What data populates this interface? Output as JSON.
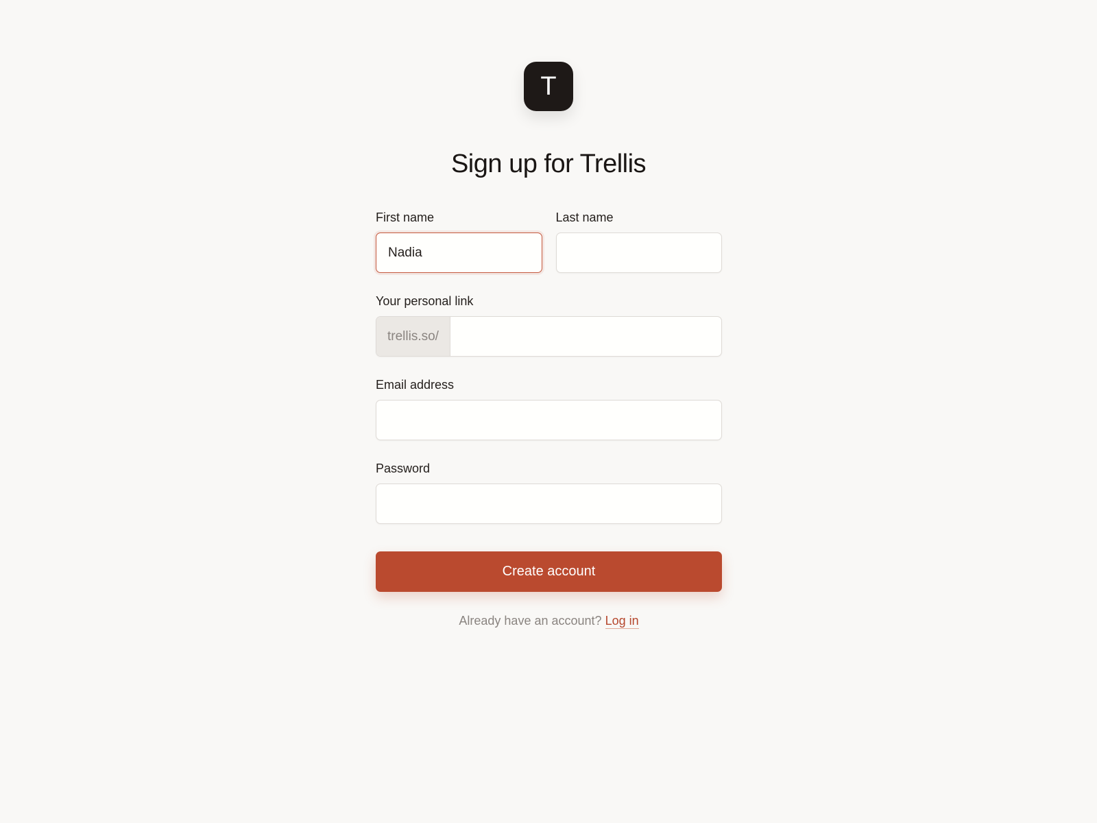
{
  "app": {
    "logo_letter": "T",
    "title": "Sign up for Trellis"
  },
  "form": {
    "first_name": {
      "label": "First name",
      "value": "Nadia",
      "placeholder": ""
    },
    "last_name": {
      "label": "Last name",
      "value": "",
      "placeholder": ""
    },
    "personal_link": {
      "label": "Your personal link",
      "prefix": "trellis.so/",
      "value": ""
    },
    "email": {
      "label": "Email address",
      "value": ""
    },
    "password": {
      "label": "Password",
      "value": ""
    },
    "submit_label": "Create account"
  },
  "footer": {
    "prompt": "Already have an account?",
    "login_label": "Log in"
  },
  "colors": {
    "background": "#f9f8f6",
    "accent": "#ba4a2f",
    "logo_bg": "#1e1917",
    "focus_border": "#c4573c"
  }
}
